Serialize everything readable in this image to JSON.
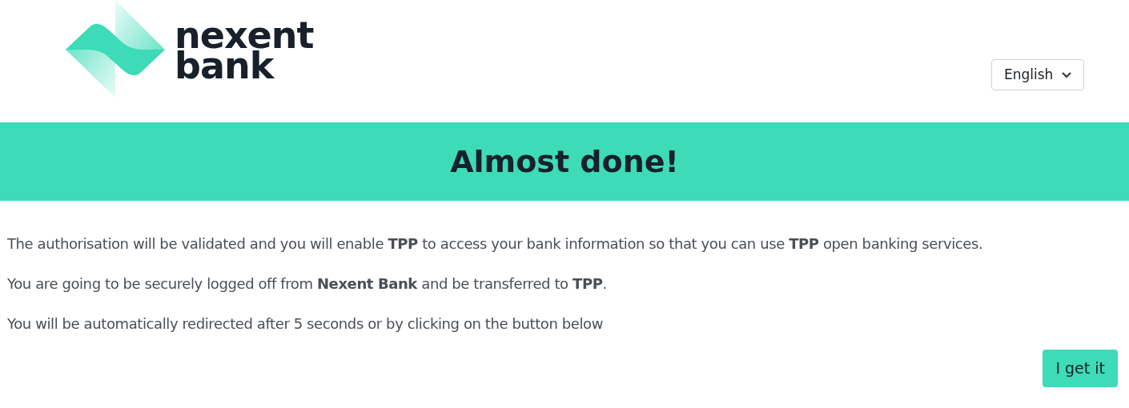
{
  "logo": {
    "lines": [
      "nexent",
      "bank"
    ]
  },
  "language_select": {
    "value": "English"
  },
  "banner": {
    "title": "Almost done!"
  },
  "paragraphs": [
    "The authorisation will be validated and you will enable **TPP** to access your bank information so that you can use **TPP** open banking services.",
    "You are going to be securely logged off from **Nexent Bank** and be transferred to **TPP**.",
    "You will be automatically redirected after 5 seconds or by clicking on the button below"
  ],
  "button": {
    "label": "I get it"
  }
}
